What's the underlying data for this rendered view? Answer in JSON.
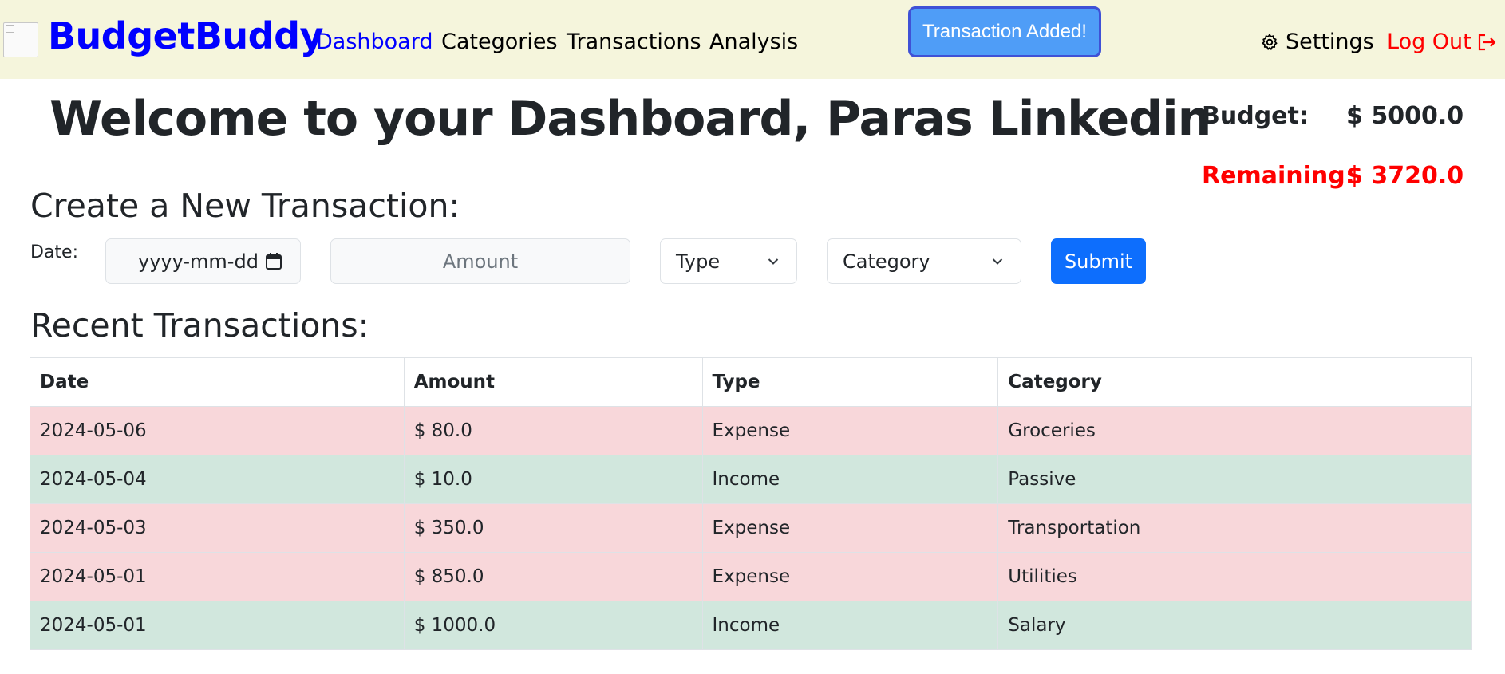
{
  "app": {
    "brand": "BudgetBuddy"
  },
  "nav": {
    "links": [
      {
        "label": "Dashboard",
        "active": true
      },
      {
        "label": "Categories",
        "active": false
      },
      {
        "label": "Transactions",
        "active": false
      },
      {
        "label": "Analysis",
        "active": false
      }
    ],
    "toast": "Transaction Added!",
    "settings_label": "Settings",
    "logout_label": "Log Out"
  },
  "header": {
    "title": "Welcome to your Dashboard, Paras Linkedin",
    "budget_label": "Budget:",
    "budget_value": "$ 5000.0",
    "remaining_label": "Remaining:",
    "remaining_value": "$ 3720.0"
  },
  "form": {
    "title": "Create a New Transaction:",
    "date_label": "Date:",
    "date_placeholder": "yyyy-mm-dd",
    "amount_placeholder": "Amount",
    "type_selected": "Type",
    "category_selected": "Category",
    "submit_label": "Submit"
  },
  "recent": {
    "title": "Recent Transactions:",
    "columns": [
      "Date",
      "Amount",
      "Type",
      "Category"
    ],
    "rows": [
      {
        "date": "2024-05-06",
        "amount": "$ 80.0",
        "type": "Expense",
        "category": "Groceries"
      },
      {
        "date": "2024-05-04",
        "amount": "$ 10.0",
        "type": "Income",
        "category": "Passive"
      },
      {
        "date": "2024-05-03",
        "amount": "$ 350.0",
        "type": "Expense",
        "category": "Transportation"
      },
      {
        "date": "2024-05-01",
        "amount": "$ 850.0",
        "type": "Expense",
        "category": "Utilities"
      },
      {
        "date": "2024-05-01",
        "amount": "$ 1000.0",
        "type": "Income",
        "category": "Salary"
      }
    ]
  },
  "colors": {
    "navbar_bg": "#f5f5dc",
    "brand": "#0000ff",
    "danger": "#ff0000",
    "primary": "#0d6efd",
    "toast": "#4f9df7",
    "expense_row": "#f8d7da",
    "income_row": "#d1e7dd"
  },
  "icons": {
    "logo": "broken-image-icon",
    "settings": "gear-icon",
    "logout": "logout-arrow-icon",
    "calendar": "calendar-icon",
    "select": "chevron-down-icon"
  }
}
